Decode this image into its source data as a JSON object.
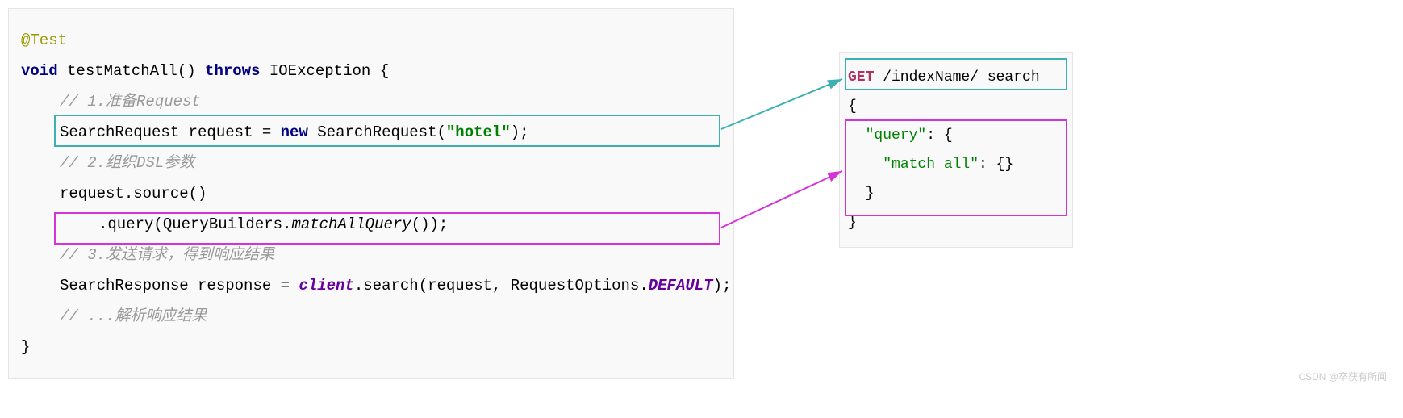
{
  "code": {
    "annotation": "@Test",
    "sig_void": "void",
    "sig_name": " testMatchAll() ",
    "sig_throws": "throws",
    "sig_exc": " IOException {",
    "comment1": "// 1.准备Request",
    "line2_a": "SearchRequest request = ",
    "line2_new": "new",
    "line2_b": " SearchRequest(",
    "line2_str": "\"hotel\"",
    "line2_c": ");",
    "comment2": "// 2.组织DSL参数",
    "line4": "request.source()",
    "line5_a": ".query(QueryBuilders.",
    "line5_m": "matchAllQuery",
    "line5_b": "());",
    "comment3": "// 3.发送请求，得到响应结果",
    "line7_a": "SearchResponse response = ",
    "line7_client": "client",
    "line7_b": ".search(request, RequestOptions.",
    "line7_default": "DEFAULT",
    "line7_c": ");",
    "comment4": "// ...解析响应结果",
    "close": "}"
  },
  "dsl": {
    "http_method": "GET",
    "path": " /indexName/_search",
    "brace_open": "{",
    "query_key": "\"query\"",
    "colon_brace": ": {",
    "match_all_key": "\"match_all\"",
    "match_all_val": ": {}",
    "inner_close": "}",
    "brace_close": "}"
  },
  "watermark": "CSDN @卒获有所闻"
}
